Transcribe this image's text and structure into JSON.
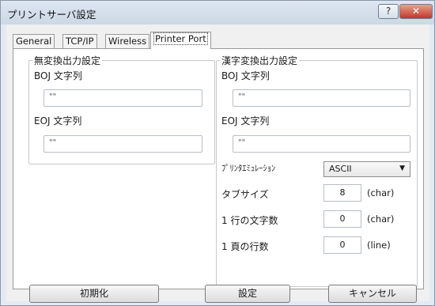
{
  "window": {
    "title": "プリントサーバ設定"
  },
  "titlebar": {
    "help_glyph": "?",
    "close_glyph": "✕"
  },
  "tabs": [
    "General",
    "TCP/IP",
    "Wireless",
    "Printer Port"
  ],
  "active_tab": "Printer Port",
  "left_group": {
    "legend": "無変換出力設定",
    "boj_label": "BOJ 文字列",
    "boj_value": "\"\"",
    "eoj_label": "EOJ 文字列",
    "eoj_value": "\"\""
  },
  "right_group": {
    "legend": "漢字変換出力設定",
    "boj_label": "BOJ 文字列",
    "boj_value": "\"\"",
    "eoj_label": "EOJ 文字列",
    "eoj_value": "\"\"",
    "emulation_label": "ﾌﾟﾘﾝﾀｴﾐｭﾚｰｼｮﾝ",
    "emulation_value": "ASCII",
    "tab_size_label": "タブサイズ",
    "tab_size_value": "8",
    "tab_size_unit": "(char)",
    "chars_per_line_label": "1 行の文字数",
    "chars_per_line_value": "0",
    "chars_per_line_unit": "(char)",
    "lines_per_page_label": "1 頁の行数",
    "lines_per_page_value": "0",
    "lines_per_page_unit": "(line)"
  },
  "buttons": {
    "init": "初期化",
    "set": "設定",
    "cancel": "キャンセル"
  }
}
